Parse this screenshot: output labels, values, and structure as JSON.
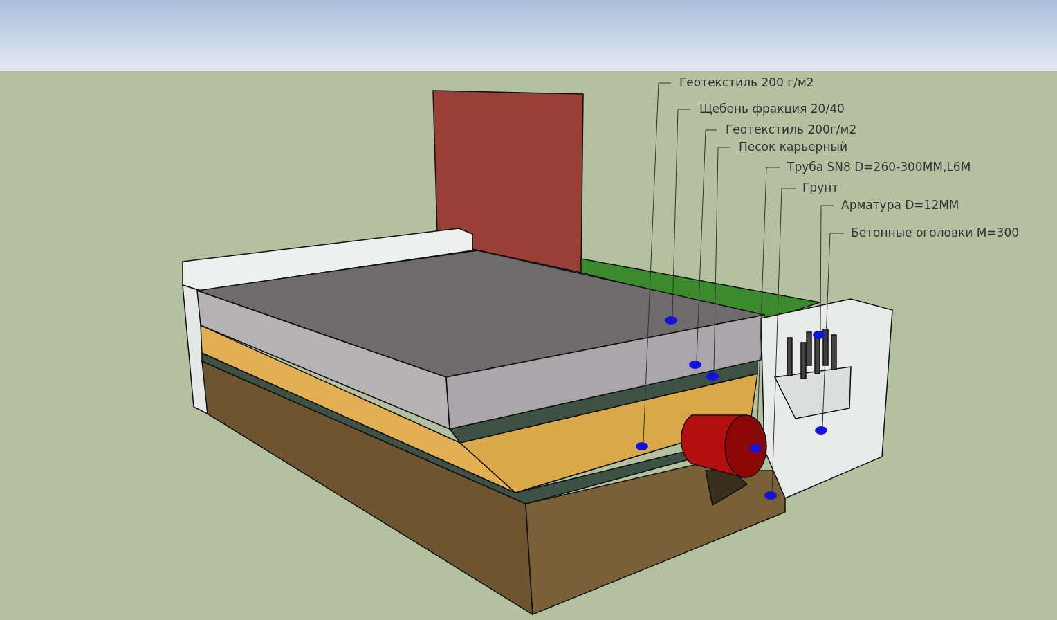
{
  "callouts": [
    {
      "text": "Геотекстиль 200 г/м2"
    },
    {
      "text": "Щебень фракция 20/40"
    },
    {
      "text": "Геотекстиль 200г/м2"
    },
    {
      "text": "Песок карьерный"
    },
    {
      "text": "Труба SN8 D=260-300ММ,L6M"
    },
    {
      "text": "Грунт"
    },
    {
      "text": "Арматура D=12ММ"
    },
    {
      "text": "Бетонные оголовки М=300"
    }
  ]
}
